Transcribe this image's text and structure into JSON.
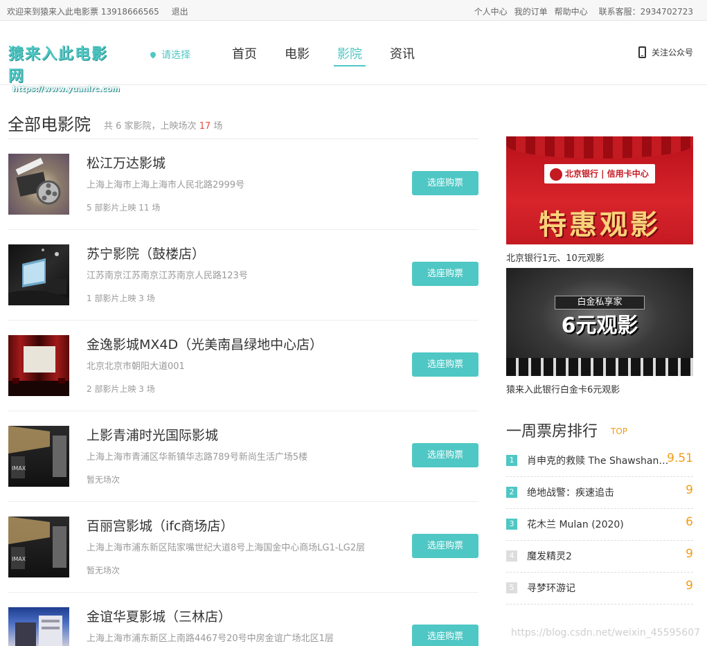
{
  "topbar": {
    "welcome": "欢迎来到猿来入此电影票 13918666565",
    "logout": "退出",
    "links": [
      "个人中心",
      "我的订单",
      "帮助中心"
    ],
    "service": "联系客服：2934702723"
  },
  "header": {
    "logo_text": "猿来入此电影网",
    "logo_url": "https://www.yuanlrc.com",
    "city": "请选择",
    "nav": [
      "首页",
      "电影",
      "影院",
      "资讯"
    ],
    "nav_active": "影院",
    "follow": "关注公众号"
  },
  "main": {
    "title": "全部电影院",
    "sub_prefix": "共 6 家影院，上映场次",
    "sub_count": "17",
    "sub_suffix": "场",
    "button_label": "选座购票",
    "cinemas": [
      {
        "name": "松江万达影城",
        "address": "上海上海市上海上海市人民北路2999号",
        "stat": "5 部影片上映 11 场"
      },
      {
        "name": "苏宁影院（鼓楼店）",
        "address": "江苏南京江苏南京江苏南京人民路123号",
        "stat": "1 部影片上映 3 场"
      },
      {
        "name": "金逸影城MX4D（光美南昌绿地中心店）",
        "address": "北京北京市朝阳大道001",
        "stat": "2 部影片上映 3 场"
      },
      {
        "name": "上影青浦时光国际影城",
        "address": "上海上海市青浦区华新镇华志路789号新尚生活广场5楼",
        "stat": "暂无场次"
      },
      {
        "name": "百丽宫影城（ifc商场店）",
        "address": "上海上海市浦东新区陆家嘴世纪大道8号上海国金中心商场LG1-LG2层",
        "stat": "暂无场次"
      },
      {
        "name": "金谊华夏影城（三林店）",
        "address": "上海上海市浦东新区上南路4467号20号中房金谊广场北区1层",
        "stat": ""
      }
    ]
  },
  "sidebar": {
    "ads": [
      {
        "bank": "北京银行 | 信用卡中心",
        "headline": "特惠观影",
        "caption": "北京银行1元、10元观影"
      },
      {
        "title": "白金私享家",
        "headline": "6元观影",
        "caption": "猿来入此银行白金卡6元观影"
      }
    ],
    "ranking_title": "一周票房排行",
    "ranking_badge": "TOP",
    "ranking": [
      {
        "no": "1",
        "movie": "肖申克的救赎 The Shawshank Redemption",
        "score": "9.51"
      },
      {
        "no": "2",
        "movie": "绝地战警：疾速追击",
        "score": "9"
      },
      {
        "no": "3",
        "movie": "花木兰 Mulan (2020)",
        "score": "6"
      },
      {
        "no": "4",
        "movie": "魔发精灵2",
        "score": "9"
      },
      {
        "no": "5",
        "movie": "寻梦环游记",
        "score": "9"
      }
    ]
  },
  "watermark": "https://blog.csdn.net/weixin_45595607",
  "colors": {
    "accent": "#4fc7c4",
    "score": "#f39c12",
    "highlight": "#e74c3c"
  }
}
